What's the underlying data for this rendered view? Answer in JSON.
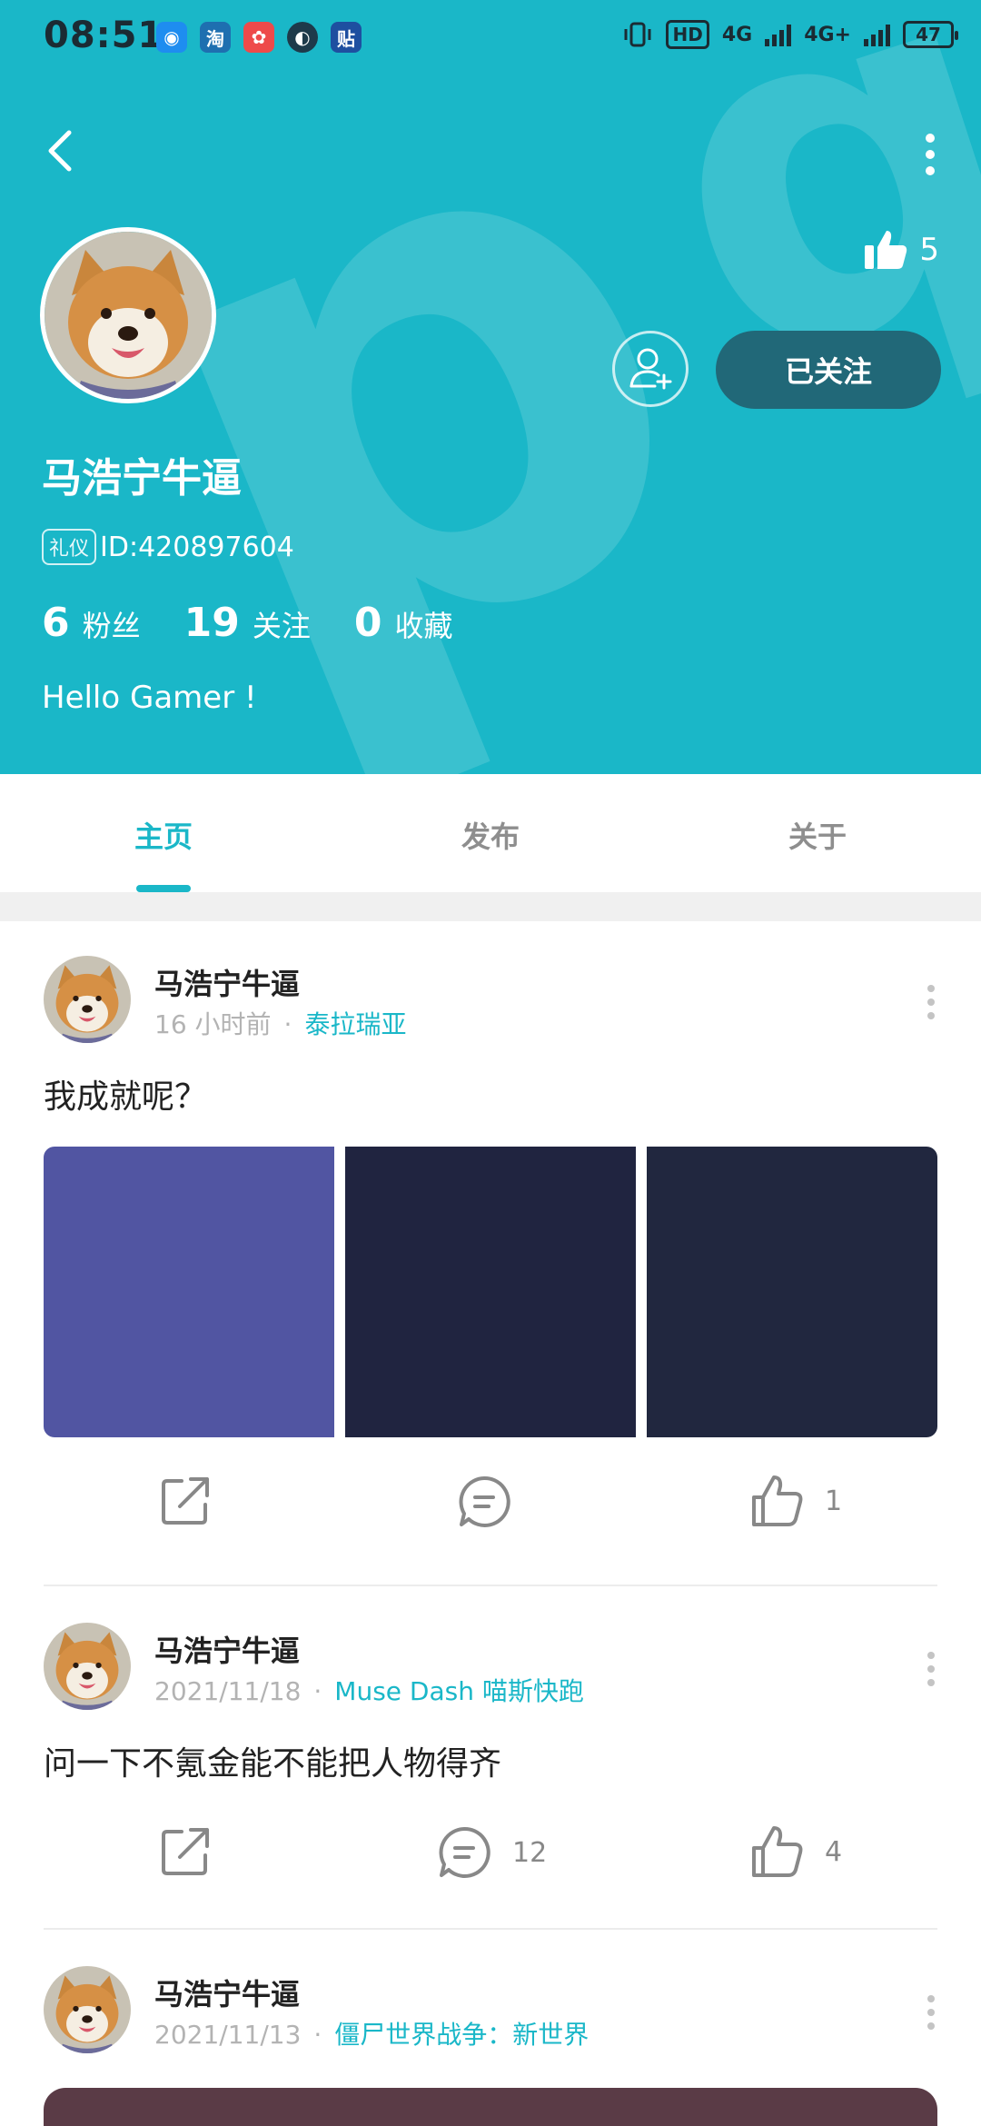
{
  "status_bar": {
    "time": "08:51",
    "app_icons": [
      {
        "name": "qq-icon",
        "glyph": "◉",
        "color": "#1e8df0"
      },
      {
        "name": "taobao-icon",
        "glyph": "淘",
        "color": "#1e6fb0"
      },
      {
        "name": "xiaohongshu-icon",
        "glyph": "ꔷ",
        "color": "#ee4a4a"
      },
      {
        "name": "browser-icon",
        "glyph": "◐",
        "color": "#1e3a4a"
      },
      {
        "name": "tieba-icon",
        "glyph": "贴",
        "color": "#1e4fa0"
      }
    ],
    "network_1": "4G",
    "network_2": "4G+",
    "hd_label": "HD",
    "battery": "47"
  },
  "profile": {
    "name": "马浩宁牛逼",
    "id_tag": "礼仪",
    "id_text": "ID:420897604",
    "likes": "5",
    "follow_label": "已关注",
    "stats": [
      {
        "num": "6",
        "label": "粉丝"
      },
      {
        "num": "19",
        "label": "关注"
      },
      {
        "num": "0",
        "label": "收藏"
      }
    ],
    "bio": "Hello Gamer !",
    "watermark": "TapTap"
  },
  "tabs": [
    {
      "label": "主页",
      "active": true
    },
    {
      "label": "发布",
      "active": false
    },
    {
      "label": "关于",
      "active": false
    }
  ],
  "posts": [
    {
      "author": "马浩宁牛逼",
      "time": "16 小时前",
      "category": "泰拉瑞亚",
      "text": "我成就呢？",
      "images": [
        "#5155a2",
        "#202440",
        "#21273f"
      ],
      "comments": "",
      "likes": "1"
    },
    {
      "author": "马浩宁牛逼",
      "time": "2021/11/18",
      "category": "Muse Dash 喵斯快跑",
      "text": "问一下不氪金能不能把人物得齐",
      "comments": "12",
      "likes": "4"
    },
    {
      "author": "马浩宁牛逼",
      "time": "2021/11/13",
      "category": "僵尸世界战争：新世界"
    }
  ],
  "colors": {
    "accent": "#1ab7c8",
    "follow_button": "#216878"
  }
}
